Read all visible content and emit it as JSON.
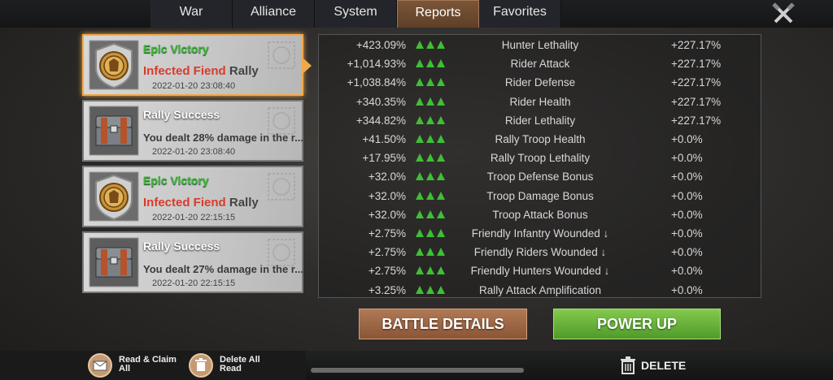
{
  "tabs": [
    {
      "label": "War",
      "active": false
    },
    {
      "label": "Alliance",
      "active": false
    },
    {
      "label": "System",
      "active": false
    },
    {
      "label": "Reports",
      "active": true
    },
    {
      "label": "Favorites",
      "active": false
    }
  ],
  "reports": [
    {
      "title": "Epic Victory",
      "type": "victory",
      "enemy": "Infected Fiend",
      "suffix": " Rally",
      "time": "2022-01-20 23:08:40",
      "icon": "gold-medal-icon",
      "selected": true
    },
    {
      "title": "Rally Success",
      "type": "success",
      "text": "You dealt 28% damage in the r...",
      "time": "2022-01-20 23:08:40",
      "icon": "chest-icon"
    },
    {
      "title": "Epic Victory",
      "type": "victory",
      "enemy": "Infected Fiend",
      "suffix": " Rally",
      "time": "2022-01-20 22:15:15",
      "icon": "gold-medal-icon"
    },
    {
      "title": "Rally Success",
      "type": "success",
      "text": "You dealt 27% damage in the r...",
      "time": "2022-01-20 22:15:15",
      "icon": "chest-icon"
    }
  ],
  "stats": [
    {
      "mine": "+423.09%",
      "name": "Hunter Lethality",
      "enemy": "+227.17%"
    },
    {
      "mine": "+1,014.93%",
      "name": "Rider Attack",
      "enemy": "+227.17%"
    },
    {
      "mine": "+1,038.84%",
      "name": "Rider Defense",
      "enemy": "+227.17%"
    },
    {
      "mine": "+340.35%",
      "name": "Rider Health",
      "enemy": "+227.17%"
    },
    {
      "mine": "+344.82%",
      "name": "Rider Lethality",
      "enemy": "+227.17%"
    },
    {
      "mine": "+41.50%",
      "name": "Rally Troop Health",
      "enemy": "+0.0%"
    },
    {
      "mine": "+17.95%",
      "name": "Rally Troop Lethality",
      "enemy": "+0.0%"
    },
    {
      "mine": "+32.0%",
      "name": "Troop Defense Bonus",
      "enemy": "+0.0%"
    },
    {
      "mine": "+32.0%",
      "name": "Troop Damage Bonus",
      "enemy": "+0.0%"
    },
    {
      "mine": "+32.0%",
      "name": "Troop Attack Bonus",
      "enemy": "+0.0%"
    },
    {
      "mine": "+2.75%",
      "name": "Friendly Infantry Wounded ↓",
      "enemy": "+0.0%"
    },
    {
      "mine": "+2.75%",
      "name": "Friendly Riders Wounded ↓",
      "enemy": "+0.0%"
    },
    {
      "mine": "+2.75%",
      "name": "Friendly Hunters Wounded ↓",
      "enemy": "+0.0%"
    },
    {
      "mine": "+3.25%",
      "name": "Rally Attack Amplification",
      "enemy": "+0.0%"
    }
  ],
  "buttons": {
    "battle_details": "BATTLE DETAILS",
    "power_up": "POWER UP"
  },
  "bottom": {
    "read_claim_line1": "Read & Claim",
    "read_claim_line2": "All",
    "delete_all_line1": "Delete All",
    "delete_all_line2": "Read",
    "delete": "DELETE"
  },
  "colors": {
    "victory_green": "#3db62d",
    "enemy_red": "#d93a2b",
    "arrow_green": "#3fbf34",
    "accent_orange": "#f0a94a"
  }
}
